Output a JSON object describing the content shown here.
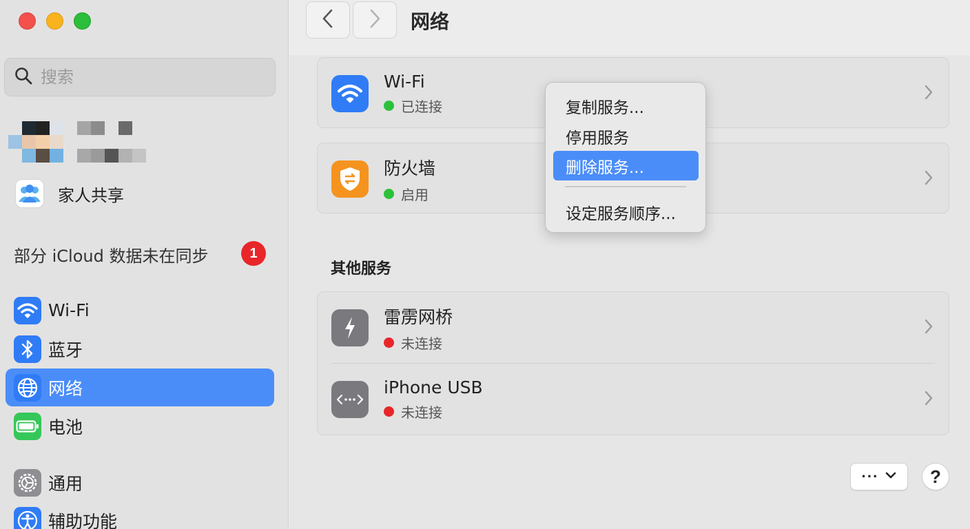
{
  "window": {
    "title": "网络"
  },
  "search": {
    "placeholder": "搜索"
  },
  "sidebar": {
    "family_label": "家人共享",
    "sync_text": "部分 iCloud 数据未在同步",
    "sync_badge": "1",
    "items": [
      {
        "label": "Wi-Fi",
        "icon": "wifi-icon"
      },
      {
        "label": "蓝牙",
        "icon": "bluetooth-icon"
      },
      {
        "label": "网络",
        "icon": "globe-icon",
        "selected": true
      },
      {
        "label": "电池",
        "icon": "battery-icon"
      },
      {
        "label": "通用",
        "icon": "gear-icon"
      },
      {
        "label": "辅助功能",
        "icon": "accessibility-icon"
      }
    ]
  },
  "services": [
    {
      "name": "Wi-Fi",
      "status": "已连接",
      "status_color": "#2cc13a"
    },
    {
      "name": "防火墙",
      "status": "启用",
      "status_color": "#2cc13a"
    }
  ],
  "other_services": {
    "title": "其他服务",
    "items": [
      {
        "name": "雷雳网桥",
        "status": "未连接",
        "status_color": "#e8262a"
      },
      {
        "name": "iPhone USB",
        "status": "未连接",
        "status_color": "#e8262a"
      }
    ]
  },
  "context_menu": {
    "items": [
      {
        "label": "复制服务..."
      },
      {
        "label": "停用服务"
      },
      {
        "label": "删除服务...",
        "highlighted": true
      },
      {
        "label": "设定服务顺序..."
      }
    ]
  },
  "footer": {
    "more_label": "···",
    "help_label": "?"
  },
  "colors": {
    "accent": "#4b8df8",
    "badge": "#e8262a"
  }
}
